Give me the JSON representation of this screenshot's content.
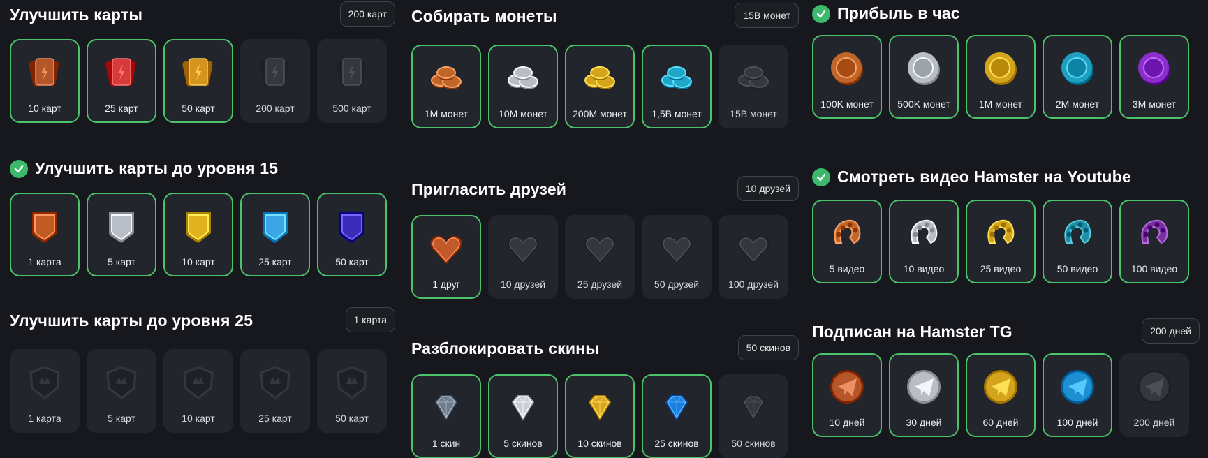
{
  "columns": [
    {
      "sections": [
        {
          "title": "Улучшить карты",
          "done": false,
          "badge": "200 карт",
          "kind": "cards",
          "items": [
            {
              "label": "10 карт",
              "done": true,
              "color": "#b4552a"
            },
            {
              "label": "25 карт",
              "done": true,
              "color": "#d63a3a"
            },
            {
              "label": "50 карт",
              "done": true,
              "color": "#d4941d"
            },
            {
              "label": "200 карт",
              "done": false,
              "color": "#4a4d52"
            },
            {
              "label": "500 карт",
              "done": false,
              "color": "#4a4d52"
            }
          ]
        },
        {
          "title": "Улучшить карты до уровня 15",
          "done": true,
          "badge": "",
          "kind": "shield",
          "items": [
            {
              "label": "1 карта",
              "done": true,
              "color": "#c25a24"
            },
            {
              "label": "5 карт",
              "done": true,
              "color": "#b9bec6"
            },
            {
              "label": "10 карт",
              "done": true,
              "color": "#e0b21e"
            },
            {
              "label": "25 карт",
              "done": true,
              "color": "#3aa6e6"
            },
            {
              "label": "50 карт",
              "done": true,
              "color": "#3b2bb7"
            }
          ]
        },
        {
          "title": "Улучшить карты до уровня 25",
          "done": false,
          "badge": "1 карта",
          "kind": "badge",
          "items": [
            {
              "label": "1 карта",
              "done": false,
              "color": "#4a4d52"
            },
            {
              "label": "5 карт",
              "done": false,
              "color": "#4a4d52"
            },
            {
              "label": "10 карт",
              "done": false,
              "color": "#4a4d52"
            },
            {
              "label": "25 карт",
              "done": false,
              "color": "#4a4d52"
            },
            {
              "label": "50 карт",
              "done": false,
              "color": "#4a4d52"
            }
          ]
        }
      ]
    },
    {
      "sections": [
        {
          "title": "Собирать монеты",
          "done": false,
          "badge": "15B монет",
          "kind": "coins",
          "items": [
            {
              "label": "1M монет",
              "done": true,
              "color": "#c0662a"
            },
            {
              "label": "10M монет",
              "done": true,
              "color": "#b9bec6"
            },
            {
              "label": "200M монет",
              "done": true,
              "color": "#d4a51c"
            },
            {
              "label": "1,5B монет",
              "done": true,
              "color": "#1fa6c9"
            },
            {
              "label": "15B монет",
              "done": false,
              "color": "#4a4d52"
            }
          ]
        },
        {
          "title": "Пригласить друзей",
          "done": false,
          "badge": "10 друзей",
          "kind": "heart",
          "items": [
            {
              "label": "1 друг",
              "done": true,
              "color": "#c05a2a"
            },
            {
              "label": "10 друзей",
              "done": false,
              "color": "#4a4d52"
            },
            {
              "label": "25 друзей",
              "done": false,
              "color": "#4a4d52"
            },
            {
              "label": "50 друзей",
              "done": false,
              "color": "#4a4d52"
            },
            {
              "label": "100 друзей",
              "done": false,
              "color": "#4a4d52"
            }
          ]
        },
        {
          "title": "Разблокировать скины",
          "done": false,
          "badge": "50 скинов",
          "kind": "gem",
          "items": [
            {
              "label": "1 скин",
              "done": true,
              "color": "#6f7c8c"
            },
            {
              "label": "5 скинов",
              "done": true,
              "color": "#c9ced6"
            },
            {
              "label": "10 скинов",
              "done": true,
              "color": "#d9a51f"
            },
            {
              "label": "25 скинов",
              "done": true,
              "color": "#1c7fe0"
            },
            {
              "label": "50 скинов",
              "done": false,
              "color": "#4a4d52"
            }
          ]
        }
      ]
    },
    {
      "sections": [
        {
          "title": "Прибыль в час",
          "done": true,
          "badge": "",
          "kind": "coin",
          "items": [
            {
              "label": "100K монет",
              "done": true,
              "color": "#c0662a"
            },
            {
              "label": "500K монет",
              "done": true,
              "color": "#b9bec6"
            },
            {
              "label": "1M монет",
              "done": true,
              "color": "#d4a51c"
            },
            {
              "label": "2M монет",
              "done": true,
              "color": "#1f9fc0"
            },
            {
              "label": "3M монет",
              "done": true,
              "color": "#8a2fc9"
            }
          ]
        },
        {
          "title": "Смотреть видео Hamster на Youtube",
          "done": true,
          "badge": "",
          "kind": "reel",
          "items": [
            {
              "label": "5 видео",
              "done": true,
              "color": "#c0662a"
            },
            {
              "label": "10 видео",
              "done": true,
              "color": "#b9bec6"
            },
            {
              "label": "25 видео",
              "done": true,
              "color": "#d4a51c"
            },
            {
              "label": "50 видео",
              "done": true,
              "color": "#1f8fa6"
            },
            {
              "label": "100 видео",
              "done": true,
              "color": "#7a2fa0"
            }
          ]
        },
        {
          "title": "Подписан на Hamster TG",
          "done": false,
          "badge": "200 дней",
          "kind": "plane",
          "items": [
            {
              "label": "10 дней",
              "done": true,
              "color": "#b4552a"
            },
            {
              "label": "30 дней",
              "done": true,
              "color": "#b9bec6"
            },
            {
              "label": "60 дней",
              "done": true,
              "color": "#d4a51c"
            },
            {
              "label": "100 дней",
              "done": true,
              "color": "#1e8fd0"
            },
            {
              "label": "200 дней",
              "done": false,
              "color": "#4a4d52"
            }
          ]
        }
      ]
    }
  ]
}
